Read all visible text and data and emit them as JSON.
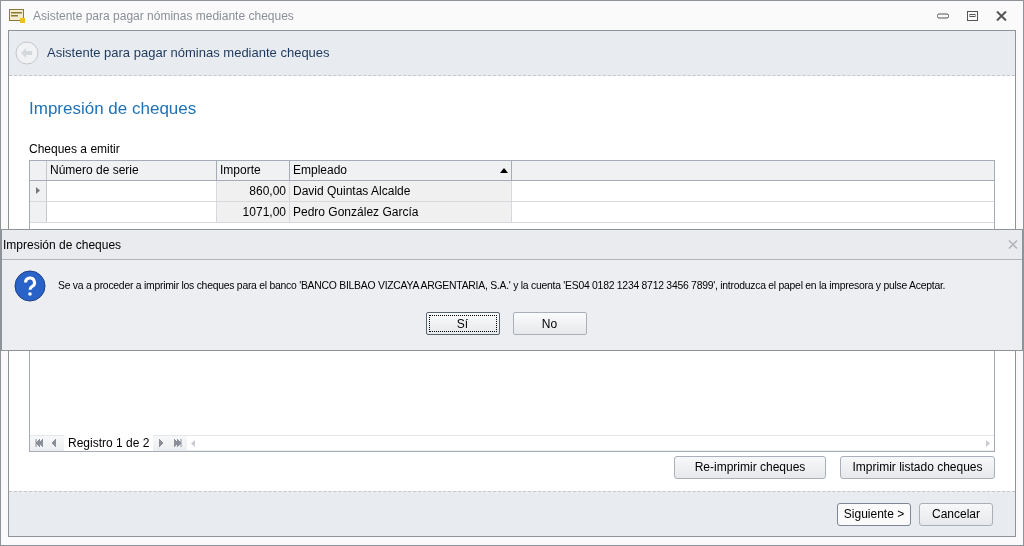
{
  "window": {
    "title": "Asistente para pagar nóminas mediante cheques"
  },
  "header": {
    "title": "Asistente para pagar nóminas mediante cheques"
  },
  "page_title": "Impresión de cheques",
  "grid": {
    "label": "Cheques a emitir",
    "columns": [
      {
        "label": "Número de serie",
        "sorted": false
      },
      {
        "label": "Importe",
        "sorted": false
      },
      {
        "label": "Empleado",
        "sorted": true
      }
    ],
    "rows": [
      {
        "current": true,
        "cells": [
          "",
          "860,00",
          "David Quintas Alcalde"
        ]
      },
      {
        "current": false,
        "cells": [
          "",
          "1071,00",
          "Pedro González García"
        ]
      }
    ],
    "navigator": "Registro 1 de 2"
  },
  "actions": [
    "Re-imprimir cheques",
    "Imprimir listado cheques"
  ],
  "footer_buttons": [
    {
      "label": "Siguiente >",
      "default": true
    },
    {
      "label": "Cancelar",
      "default": false
    }
  ],
  "dialog": {
    "title": "Impresión de cheques",
    "message": "Se va a proceder a imprimir los cheques para el banco 'BANCO BILBAO VIZCAYA ARGENTARIA, S.A.' y la cuenta 'ES04 0182 1234 8712 3456 7899', introduzca el papel en la impresora y pulse Aceptar.",
    "buttons": [
      {
        "label": "Sí",
        "focused": true
      },
      {
        "label": "No",
        "focused": false
      }
    ]
  }
}
